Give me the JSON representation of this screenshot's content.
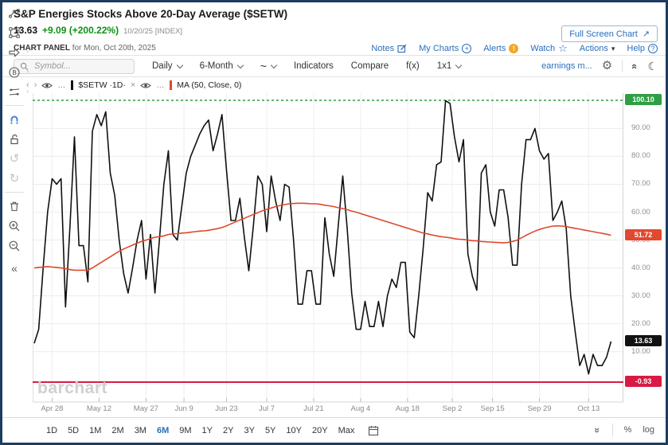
{
  "header": {
    "title": "S&P Energies Stocks Above 20-Day Average ($SETW)",
    "last": "13.63",
    "change": "+9.09 (+200.22%)",
    "date_note": "10/20/25 [INDEX]",
    "panel_label": "CHART PANEL",
    "panel_date": "for Mon, Oct 20th, 2025",
    "fullscreen_button": "Full Screen Chart",
    "fullscreen_icon": "↗",
    "links": [
      {
        "label": "Notes",
        "icon": "notes"
      },
      {
        "label": "My Charts",
        "icon": "plus-circle"
      },
      {
        "label": "Alerts",
        "icon": "alert",
        "alert_glyph": "!"
      },
      {
        "label": "Watch",
        "icon": "star",
        "star_glyph": "☆"
      },
      {
        "label": "Actions",
        "icon": "caret",
        "caret_glyph": "▾"
      },
      {
        "label": "Help",
        "icon": "question",
        "question_glyph": "?"
      }
    ]
  },
  "toolbar": {
    "symbol_placeholder": "Symbol...",
    "daily": "Daily",
    "range": "6-Month",
    "linestyle": "~",
    "indicators": "Indicators",
    "compare": "Compare",
    "fx": "f(x)",
    "grid_layout": "1x1",
    "earnings": "earnings m...",
    "gear_glyph": "⚙",
    "collapse_glyph": "«",
    "moon_glyph": "☾"
  },
  "legend": {
    "prev": "‹",
    "next": "›",
    "dots": "…",
    "series1": "$SETW ·1D·",
    "close": "×",
    "series2": "MA (50, Close, 0)"
  },
  "chart_data": {
    "type": "line",
    "title": "S&P Energies Stocks Above 20-Day Average ($SETW)",
    "ylim": [
      -7.5,
      102.4
    ],
    "grid": true,
    "upper_line": {
      "value": 100.1,
      "label": "100.10",
      "color": "#2f9e44",
      "style": "dashed"
    },
    "lower_line": {
      "value": -0.93,
      "label": "-0.93",
      "color": "#d81b44",
      "style": "solid"
    },
    "x_ticks": [
      {
        "label": "Apr 28",
        "day": 4
      },
      {
        "label": "May 12",
        "day": 14.5
      },
      {
        "label": "May 27",
        "day": 25
      },
      {
        "label": "Jun 9",
        "day": 33.5
      },
      {
        "label": "Jun 23",
        "day": 43
      },
      {
        "label": "Jul 7",
        "day": 52
      },
      {
        "label": "Jul 21",
        "day": 62.5
      },
      {
        "label": "Aug 4",
        "day": 73
      },
      {
        "label": "Aug 18",
        "day": 83.5
      },
      {
        "label": "Sep 2",
        "day": 93.5
      },
      {
        "label": "Sep 15",
        "day": 102.5
      },
      {
        "label": "Sep 29",
        "day": 113
      },
      {
        "label": "Oct 13",
        "day": 124
      }
    ],
    "y_ticks": [
      {
        "v": 90,
        "label": "90.00"
      },
      {
        "v": 80,
        "label": "80.00"
      },
      {
        "v": 70,
        "label": "70.00"
      },
      {
        "v": 60,
        "label": "60.00"
      },
      {
        "v": 50,
        "label": "50.00"
      },
      {
        "v": 40,
        "label": "40.00"
      },
      {
        "v": 30,
        "label": "30.00"
      },
      {
        "v": 20,
        "label": "20.00"
      },
      {
        "v": 10,
        "label": "10.00"
      }
    ],
    "axis_badges": [
      {
        "value": 100.1,
        "label": "100.10",
        "color": "#2f9e44"
      },
      {
        "value": 51.72,
        "label": "51.72",
        "color": "#e2492f"
      },
      {
        "value": 13.63,
        "label": "13.63",
        "color": "#111111"
      },
      {
        "value": -0.93,
        "label": "-0.93",
        "color": "#d81b44"
      }
    ],
    "series": [
      {
        "name": "$SETW",
        "color": "#111111",
        "width": 1.6,
        "values": [
          13,
          18,
          40,
          60,
          72,
          70,
          72,
          26,
          55,
          87,
          48,
          48,
          35,
          89,
          95,
          91,
          96,
          74,
          66,
          50,
          38,
          31,
          40,
          50,
          57,
          36,
          52,
          31,
          50,
          70,
          82,
          52,
          50,
          62,
          74,
          80,
          84,
          88,
          91,
          93,
          82,
          88,
          95,
          75,
          57,
          57,
          65,
          51,
          39,
          55,
          73,
          70,
          53,
          73,
          64,
          57,
          70,
          69,
          50,
          27,
          27,
          39,
          39,
          27,
          27,
          58,
          45,
          37,
          55,
          73,
          54,
          31,
          18,
          18,
          28,
          19,
          19,
          28,
          19,
          30,
          36,
          33,
          42,
          42,
          17,
          15,
          30,
          47,
          67,
          64,
          77,
          78,
          100,
          99,
          87,
          78,
          86,
          45,
          37,
          32,
          74,
          77,
          60,
          55,
          68,
          68,
          58,
          41,
          41,
          70,
          86,
          86,
          90,
          82,
          79,
          81,
          57,
          60,
          64,
          54,
          30,
          17,
          5,
          9,
          2,
          9,
          5,
          5,
          8,
          13.63
        ]
      },
      {
        "name": "MA (50, Close, 0)",
        "color": "#dd4a2b",
        "width": 1.6,
        "values": [
          40,
          40.2,
          40.3,
          40.5,
          40.3,
          40.2,
          40,
          39.7,
          39.4,
          39.2,
          39.2,
          39.2,
          39.2,
          40,
          41,
          42,
          43,
          44,
          45,
          46,
          46.8,
          47.5,
          48.2,
          48.9,
          49.5,
          50,
          50.5,
          51,
          51.2,
          51.5,
          52,
          52.2,
          52.3,
          52.5,
          52.6,
          52.8,
          53,
          53.2,
          53.3,
          53.5,
          53.8,
          54.1,
          54.5,
          55.1,
          55.8,
          56.5,
          57.2,
          57.8,
          58.5,
          59.2,
          59.8,
          60.5,
          61,
          61.5,
          62,
          62.4,
          62.7,
          63,
          63.1,
          63.2,
          63.2,
          63.1,
          63,
          63,
          62.8,
          62.5,
          62.3,
          62,
          61.6,
          61.3,
          60.9,
          60.4,
          60,
          59.5,
          59,
          58.5,
          58,
          57.5,
          57,
          56.5,
          56,
          55.5,
          55,
          54.5,
          54,
          53.5,
          53,
          52.5,
          52.2,
          51.8,
          51.5,
          51.2,
          51,
          50.8,
          50.5,
          50.3,
          50.2,
          50,
          49.8,
          49.7,
          49.5,
          49.4,
          49.3,
          49.2,
          49.1,
          49,
          49.2,
          49.5,
          50,
          50.8,
          51.7,
          52.5,
          53.2,
          53.8,
          54.3,
          54.7,
          55,
          55.1,
          55,
          54.8,
          54.5,
          54.2,
          53.9,
          53.6,
          53.3,
          53,
          52.7,
          52.4,
          52.1,
          51.72
        ]
      }
    ]
  },
  "watermark": "barchart",
  "periods": {
    "items": [
      "1D",
      "5D",
      "1M",
      "2M",
      "3M",
      "6M",
      "9M",
      "1Y",
      "2Y",
      "3Y",
      "5Y",
      "10Y",
      "20Y",
      "Max"
    ],
    "active": "6M",
    "collapse_glyph": "»",
    "scale_options": [
      "%",
      "log"
    ]
  }
}
